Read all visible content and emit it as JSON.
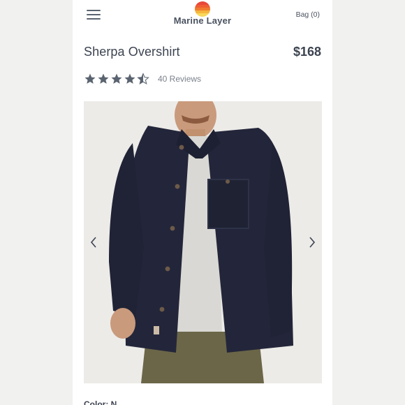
{
  "header": {
    "brand_name": "Marine Layer",
    "bag_label": "Bag (0)",
    "menu_icon": "hamburger-menu-icon",
    "logo_icon": "sunset-stripes-logo"
  },
  "product": {
    "title": "Sherpa Overshirt",
    "price": "$168",
    "rating": 4.5,
    "rating_max": 5,
    "reviews_label": "40 Reviews"
  },
  "gallery": {
    "prev_icon": "chevron-left-icon",
    "next_icon": "chevron-right-icon"
  },
  "options": {
    "color_label": "Color: N"
  },
  "colors": {
    "text": "#3c4350",
    "muted": "#7b828c",
    "star": "#5a6470",
    "logo_stripes": [
      "#e8473a",
      "#f07c2f",
      "#f6b43c",
      "#f8d85a"
    ]
  }
}
